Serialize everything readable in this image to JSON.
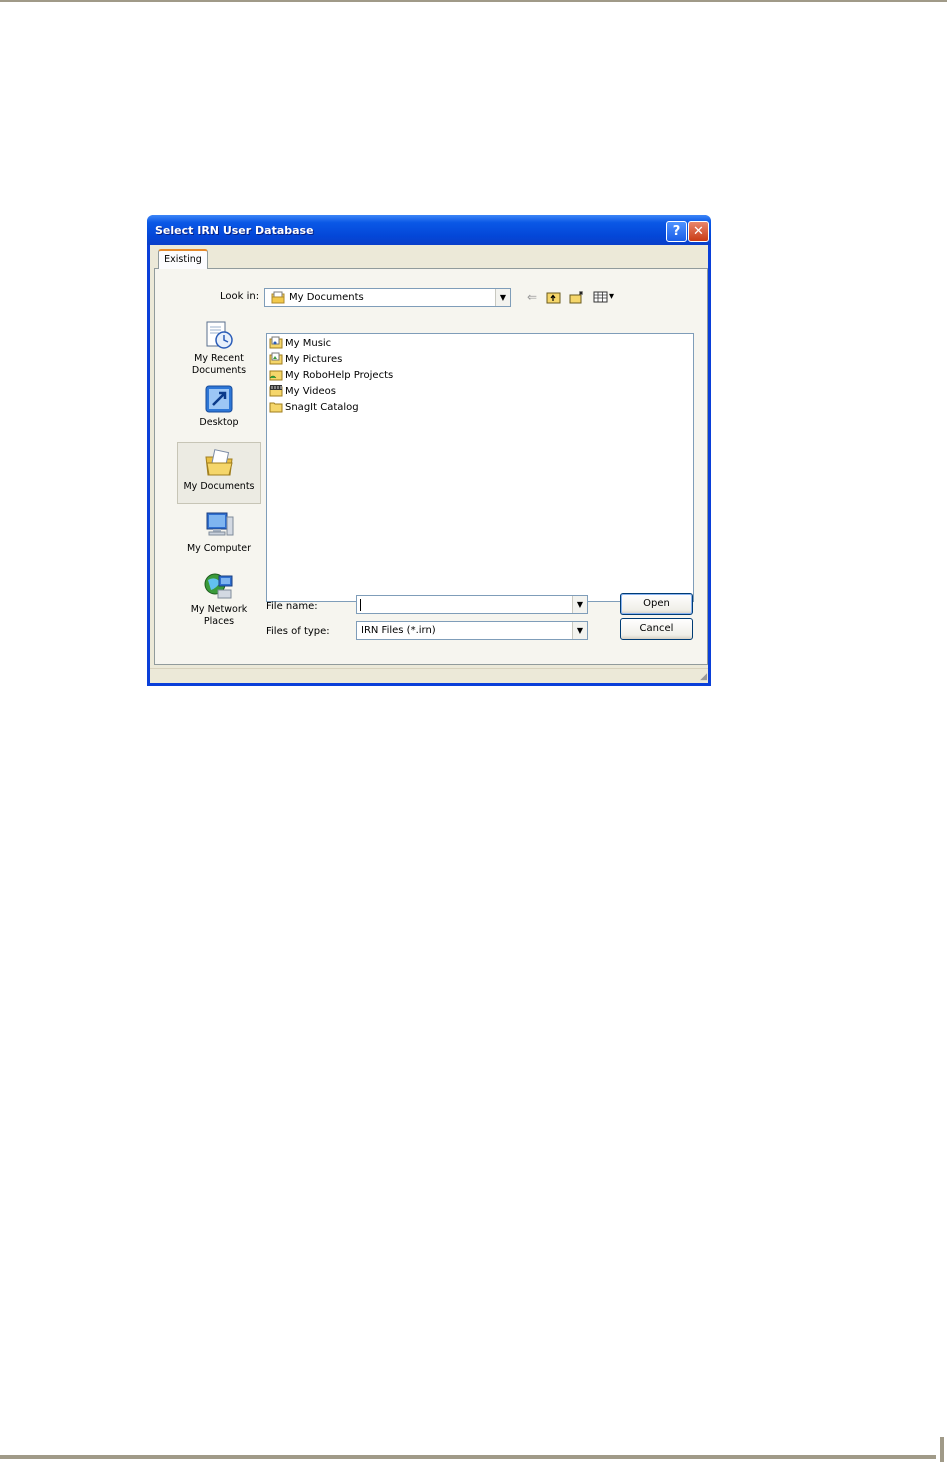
{
  "dialog": {
    "title": "Select IRN User Database",
    "help_glyph": "?",
    "close_glyph": "✕",
    "tab_label": "Existing"
  },
  "lookin": {
    "label": "Look in:",
    "value": "My Documents",
    "arrow": "▼"
  },
  "toolbar": {
    "back_glyph": "⇐",
    "view_glyph": "▾"
  },
  "places": [
    {
      "label": "My Recent Documents",
      "icon": "recent-documents-icon"
    },
    {
      "label": "Desktop",
      "icon": "desktop-icon"
    },
    {
      "label": "My Documents",
      "icon": "my-documents-icon"
    },
    {
      "label": "My Computer",
      "icon": "my-computer-icon"
    },
    {
      "label": "My Network Places",
      "icon": "network-places-icon"
    }
  ],
  "files": [
    {
      "name": "My Music",
      "icon": "music-folder-icon"
    },
    {
      "name": "My Pictures",
      "icon": "pictures-folder-icon"
    },
    {
      "name": "My RoboHelp Projects",
      "icon": "shared-folder-icon"
    },
    {
      "name": "My Videos",
      "icon": "videos-folder-icon"
    },
    {
      "name": "SnagIt Catalog",
      "icon": "folder-icon"
    }
  ],
  "filename": {
    "label": "File name:",
    "value": "",
    "arrow": "▼"
  },
  "filetype": {
    "label": "Files of type:",
    "value": "IRN Files (*.irn)",
    "arrow": "▼"
  },
  "buttons": {
    "open": "Open",
    "cancel": "Cancel"
  },
  "colors": {
    "titlebar": "#0447d8",
    "window_frame": "#0a3fd9",
    "dialog_face": "#ece9d8",
    "close_button": "#c93b15",
    "folder_yellow": "#f5d66a"
  }
}
